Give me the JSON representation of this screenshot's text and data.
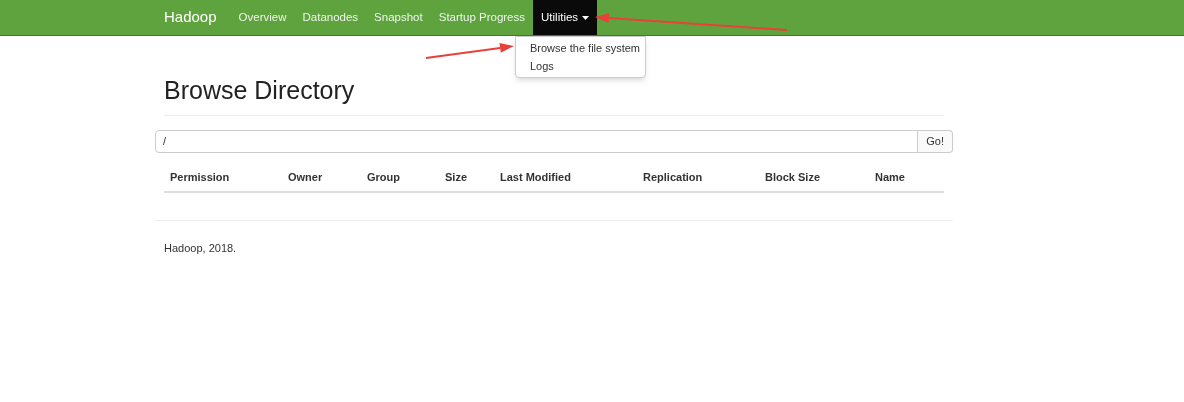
{
  "navbar": {
    "brand": "Hadoop",
    "items": [
      {
        "label": "Overview",
        "selected": false,
        "dropdown": false
      },
      {
        "label": "Datanodes",
        "selected": false,
        "dropdown": false
      },
      {
        "label": "Snapshot",
        "selected": false,
        "dropdown": false
      },
      {
        "label": "Startup Progress",
        "selected": false,
        "dropdown": false
      },
      {
        "label": "Utilities",
        "selected": true,
        "dropdown": true
      }
    ]
  },
  "dropdown_menu": [
    "Browse the file system",
    "Logs"
  ],
  "page": {
    "title": "Browse Directory",
    "path_field": {
      "value": "/"
    },
    "go_button": "Go!"
  },
  "table": {
    "columns": [
      "Permission",
      "Owner",
      "Group",
      "Size",
      "Last Modified",
      "Replication",
      "Block Size",
      "Name"
    ]
  },
  "footer": "Hadoop, 2018."
}
